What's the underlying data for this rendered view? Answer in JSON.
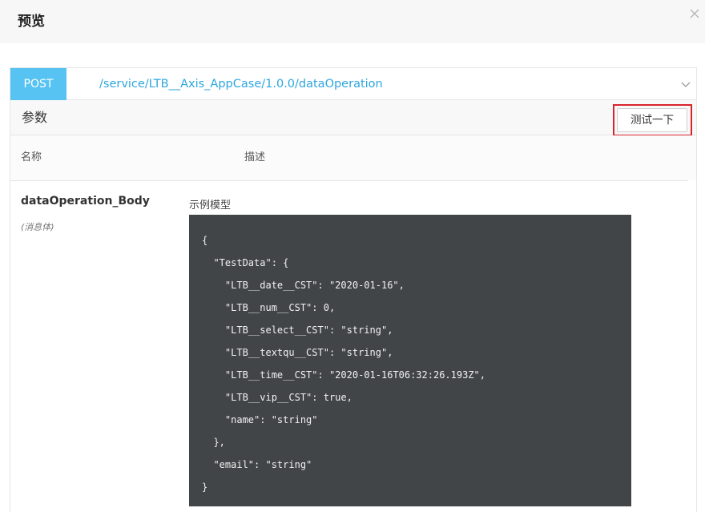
{
  "header": {
    "title": "预览",
    "close_icon": "close-icon"
  },
  "api": {
    "method": "POST",
    "path": "/service/LTB__Axis_AppCase/1.0.0/dataOperation",
    "expand_icon": "chevron-down-icon"
  },
  "params": {
    "section_title": "参数",
    "test_button_label": "测试一下",
    "highlight_color": "#d9232a",
    "columns": [
      "名称",
      "描述"
    ],
    "items": [
      {
        "name": "dataOperation_Body",
        "type": "(消息体)",
        "sample_label": "示例模型",
        "code_lines": [
          "{",
          "  \"TestData\": {",
          "    \"LTB__date__CST\": \"2020-01-16\",",
          "    \"LTB__num__CST\": 0,",
          "    \"LTB__select__CST\": \"string\",",
          "    \"LTB__textqu__CST\": \"string\",",
          "    \"LTB__time__CST\": \"2020-01-16T06:32:26.193Z\",",
          "    \"LTB__vip__CST\": true,",
          "    \"name\": \"string\"",
          "  },",
          "  \"email\": \"string\"",
          "}"
        ]
      }
    ]
  },
  "colors": {
    "method_badge": "#56c3f2",
    "path_link": "#2ea6e0",
    "code_background": "#424548"
  }
}
